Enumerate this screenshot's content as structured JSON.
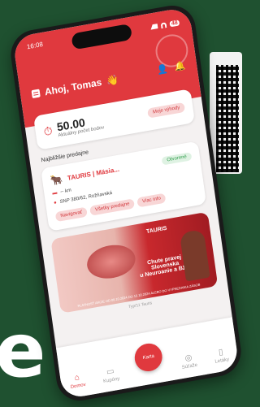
{
  "status": {
    "time": "16:08",
    "battery": "48"
  },
  "header": {
    "greeting": "Ahoj, Tomas",
    "wave_emoji": "👋"
  },
  "points": {
    "value": "50.00",
    "label": "Aktuálny počet bodov",
    "action": "Moje výhody"
  },
  "section": {
    "title": "Najbližšie predajne"
  },
  "store": {
    "name": "TAURIS | Mäsia...",
    "status": "Otvorené",
    "distance": "-- km",
    "address": "SNP 380/62, Rožňavská",
    "buttons": [
      "Navigovať",
      "Všetky predajne",
      "Viac info"
    ]
  },
  "banner": {
    "brand": "TAURIS",
    "headline": "Chute pravej Slovenska",
    "headline2": "u Neuroanie a Bžka",
    "footer": "PLATNOSŤ AKCIE OD 08.10.2024 DO 15.10.2024 ALEBO DO VYPREDANIA ZÁSOB",
    "sub": "Typ/11 Tauris"
  },
  "nav": {
    "items": [
      {
        "label": "Domov",
        "icon": "home-icon"
      },
      {
        "label": "Kupóny",
        "icon": "coupon-icon"
      },
      {
        "label": "Karta",
        "icon": "card-icon"
      },
      {
        "label": "Súťaže",
        "icon": "trophy-icon"
      },
      {
        "label": "Letáky",
        "icon": "leaflet-icon"
      }
    ]
  },
  "colors": {
    "brand_red": "#e0393e",
    "background_green": "#1f5130"
  }
}
